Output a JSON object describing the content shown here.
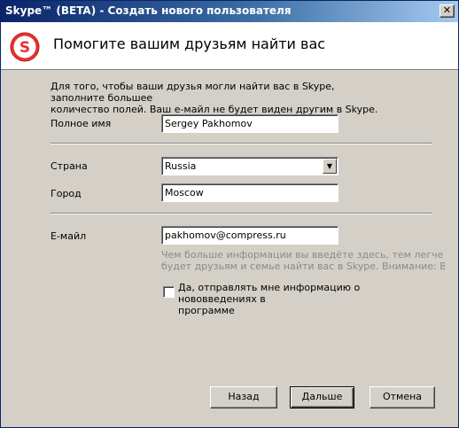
{
  "window": {
    "title": "Skype™ (BETA) - Создать нового пользователя",
    "close_glyph": "✕"
  },
  "header": {
    "title": "Помогите вашим друзьям найти вас",
    "logo_icon": "skype-logo-icon",
    "logo_letter": "S",
    "brand_color": "#e8312f"
  },
  "intro": {
    "line1": "Для того, чтобы ваши друзья могли найти вас в Skype, заполните большее",
    "line2": "количество полей. Ваш е-майл не будет виден другим в Skype."
  },
  "form": {
    "full_name": {
      "label": "Полное имя",
      "value": "Sergey Pakhomov"
    },
    "country": {
      "label": "Страна",
      "value": "Russia"
    },
    "city": {
      "label": "Город",
      "value": "Moscow"
    },
    "email": {
      "label": "Е-майл",
      "value": "pakhomov@compress.ru"
    }
  },
  "hint": {
    "line1": "Чем больше информации вы введёте здесь, тем легче",
    "line2": "будет друзьям и семье найти вас в Skype. Внимание: Ваш"
  },
  "newsletter": {
    "checked": false,
    "line1": "Да, отправлять мне информацию о нововведениях в",
    "line2": "программе"
  },
  "buttons": {
    "back": "Назад",
    "next": "Дальше",
    "cancel": "Отмена"
  }
}
